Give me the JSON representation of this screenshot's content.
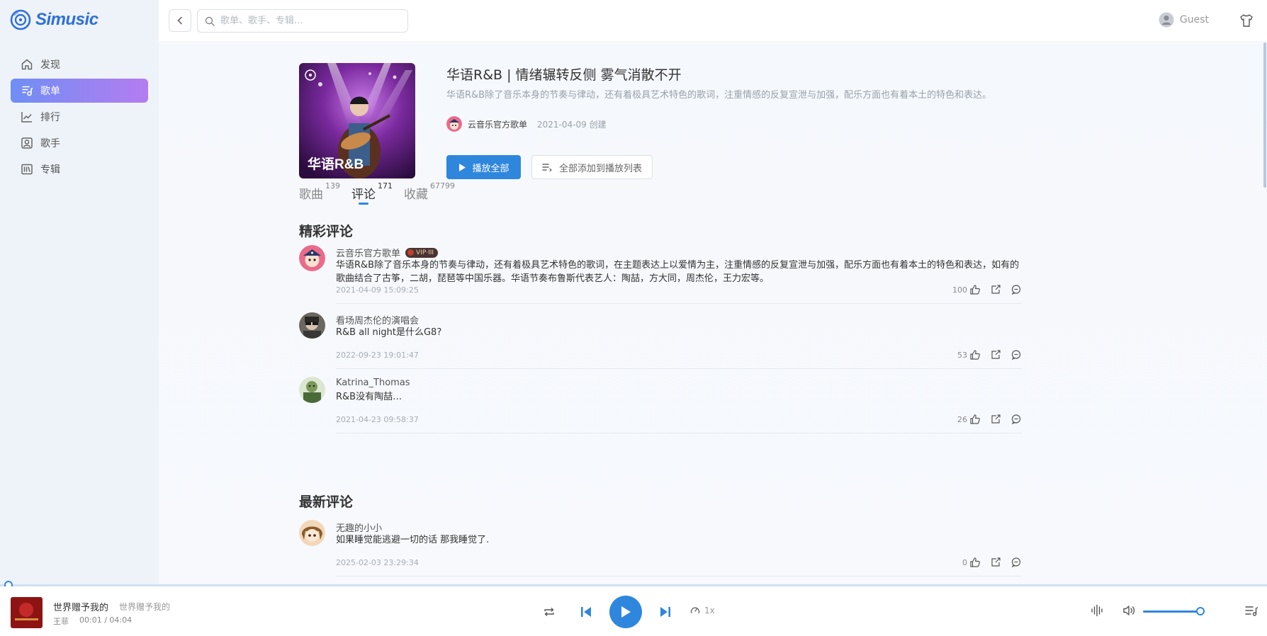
{
  "app": {
    "name": "Simusic"
  },
  "sidebar": {
    "items": [
      {
        "label": "发现",
        "icon": "home-icon",
        "active": false
      },
      {
        "label": "歌单",
        "icon": "playlist-icon",
        "active": true
      },
      {
        "label": "排行",
        "icon": "chart-icon",
        "active": false
      },
      {
        "label": "歌手",
        "icon": "singer-icon",
        "active": false
      },
      {
        "label": "专辑",
        "icon": "album-icon",
        "active": false
      }
    ]
  },
  "topbar": {
    "search_placeholder": "歌单、歌手、专辑...",
    "user_name": "Guest"
  },
  "playlist": {
    "cover_text": "华语R&B",
    "title": "华语R&B | 情绪辗转反侧 雾气消散不开",
    "description": "华语R&B除了音乐本身的节奏与律动，还有着极具艺术特色的歌词，注重情感的反复宣泄与加强，配乐方面也有着本土的特色和表达。",
    "creator": "云音乐官方歌单",
    "created": "2021-04-09 创建",
    "play_all_label": "播放全部",
    "add_all_label": "全部添加到播放列表"
  },
  "tabs": [
    {
      "label": "歌曲",
      "count": "139",
      "active": false
    },
    {
      "label": "评论",
      "count": "171",
      "active": true
    },
    {
      "label": "收藏",
      "count": "67799",
      "active": false
    }
  ],
  "hot_comments": {
    "title": "精彩评论",
    "items": [
      {
        "user": "云音乐官方歌单",
        "badge": "VIP·III",
        "text": "华语R&B除了音乐本身的节奏与律动，还有着极具艺术特色的歌词，在主题表达上以爱情为主，注重情感的反复宣泄与加强，配乐方面也有着本土的特色和表达，如有的歌曲结合了古筝，二胡，琵琶等中国乐器。华语节奏布鲁斯代表艺人：陶喆，方大同，周杰伦，王力宏等。",
        "time": "2021-04-09 15:09:25",
        "likes": "100"
      },
      {
        "user": "看场周杰伦的演唱会",
        "text": "R&B all night是什么G8?",
        "time": "2022-09-23 19:01:47",
        "likes": "53"
      },
      {
        "user": "Katrina_Thomas",
        "text": "R&B没有陶喆…",
        "time": "2021-04-23 09:58:37",
        "likes": "26"
      }
    ]
  },
  "new_comments": {
    "title": "最新评论",
    "items": [
      {
        "user": "无趣的小小",
        "text": "如果睡觉能逃避一切的话 那我睡觉了.",
        "time": "2025-02-03 23:29:34",
        "likes": "0"
      }
    ]
  },
  "player": {
    "title": "世界赠予我的",
    "album": "世界赠予我的",
    "artist": "王菲",
    "time": "00:01 / 04:04",
    "speed": "1x",
    "progress": 0.004,
    "volume": 0.9
  },
  "colors": {
    "accent": "#2f86dd",
    "sidebar_active_start": "#6f8ef5",
    "sidebar_active_end": "#b57cf0"
  }
}
